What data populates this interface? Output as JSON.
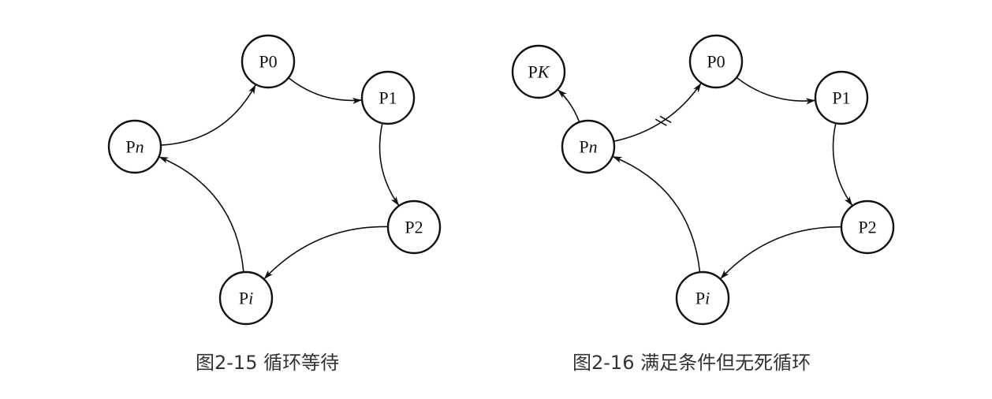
{
  "figures": [
    {
      "id": "fig-2-15",
      "caption": "图2-15  循环等待",
      "nodes": [
        {
          "id": "P0",
          "prefix": "P",
          "suffix": "0",
          "italic": false
        },
        {
          "id": "P1",
          "prefix": "P",
          "suffix": "1",
          "italic": false
        },
        {
          "id": "P2",
          "prefix": "P",
          "suffix": "2",
          "italic": false
        },
        {
          "id": "Pi",
          "prefix": "P",
          "suffix": "i",
          "italic": true
        },
        {
          "id": "Pn",
          "prefix": "P",
          "suffix": "n",
          "italic": true
        }
      ],
      "edges": [
        {
          "from": "Pn",
          "to": "P0"
        },
        {
          "from": "P0",
          "to": "P1"
        },
        {
          "from": "P1",
          "to": "P2"
        },
        {
          "from": "P2",
          "to": "Pi"
        },
        {
          "from": "Pi",
          "to": "Pn"
        }
      ]
    },
    {
      "id": "fig-2-16",
      "caption": "图2-16  满足条件但无死循环",
      "nodes": [
        {
          "id": "PK",
          "prefix": "P",
          "suffix": "K",
          "italic": true
        },
        {
          "id": "P0",
          "prefix": "P",
          "suffix": "0",
          "italic": false
        },
        {
          "id": "P1",
          "prefix": "P",
          "suffix": "1",
          "italic": false
        },
        {
          "id": "P2",
          "prefix": "P",
          "suffix": "2",
          "italic": false
        },
        {
          "id": "Pi",
          "prefix": "P",
          "suffix": "i",
          "italic": true
        },
        {
          "id": "Pn",
          "prefix": "P",
          "suffix": "n",
          "italic": true
        }
      ],
      "edges": [
        {
          "from": "Pn",
          "to": "PK"
        },
        {
          "from": "Pn",
          "to": "P0",
          "broken": true
        },
        {
          "from": "P0",
          "to": "P1"
        },
        {
          "from": "P1",
          "to": "P2"
        },
        {
          "from": "P2",
          "to": "Pi"
        },
        {
          "from": "Pi",
          "to": "Pn"
        }
      ]
    }
  ]
}
